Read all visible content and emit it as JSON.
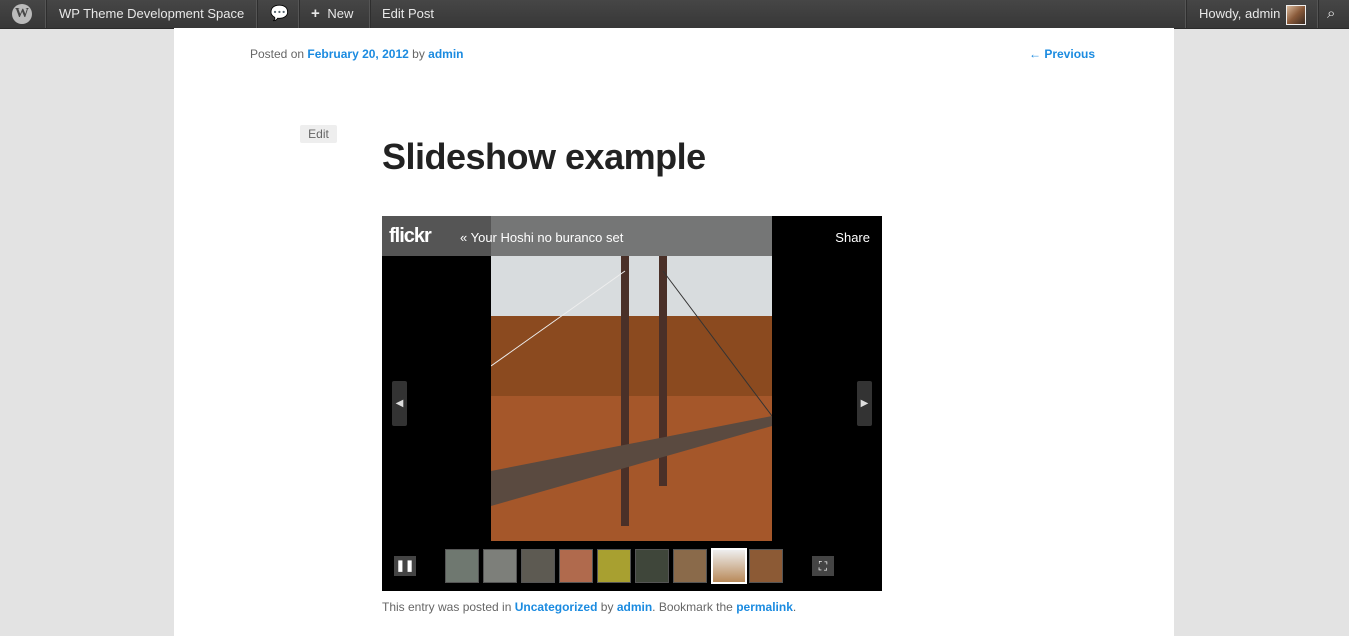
{
  "admin_bar": {
    "site_name": "WP Theme Development Space",
    "new_label": "New",
    "edit_post_label": "Edit Post",
    "howdy": "Howdy, admin"
  },
  "post": {
    "posted_on": "Posted on",
    "date": "February 20, 2012",
    "by": "by",
    "author": "admin",
    "previous_link": "← Previous",
    "edit_label": "Edit",
    "title": "Slideshow example"
  },
  "slideshow": {
    "logo_text": "flickr",
    "set_link": "« Your Hoshi no buranco set",
    "share_label": "Share",
    "thumbnails": [
      {
        "color": "#6f7870"
      },
      {
        "color": "#7d7f7a"
      },
      {
        "color": "#5d5a52"
      },
      {
        "color": "#b06a4d"
      },
      {
        "color": "#a8a030"
      },
      {
        "color": "#3f463a"
      },
      {
        "color": "#8a6a4a"
      },
      {
        "color": "#ffffff",
        "active": true
      },
      {
        "color": "#8c5a35"
      }
    ]
  },
  "footer": {
    "text1": "This entry was posted in",
    "category": "Uncategorized",
    "text2": "by",
    "author": "admin",
    "text3": ". Bookmark the",
    "permalink": "permalink",
    "text4": "."
  }
}
